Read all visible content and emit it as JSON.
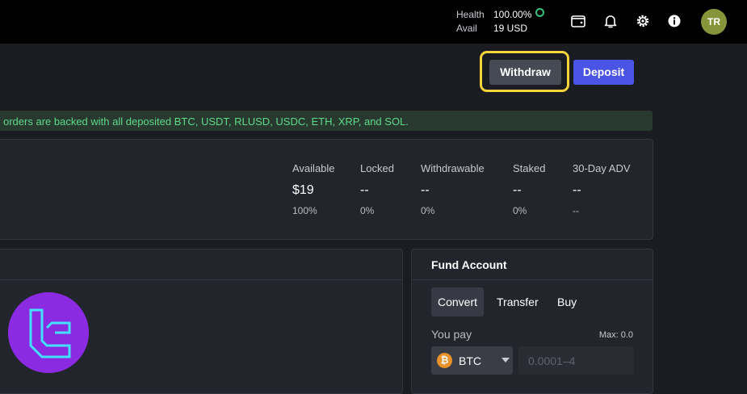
{
  "header": {
    "health_label": "Health",
    "health_value": "100.00%",
    "avail_label": "Avail",
    "avail_value": "19 USD",
    "avatar_initials": "TR",
    "icons": [
      "wallet-icon",
      "bell-icon",
      "gear-icon",
      "info-icon"
    ]
  },
  "actions": {
    "withdraw": "Withdraw",
    "deposit": "Deposit"
  },
  "banner": {
    "text": "orders are backed with all deposited BTC, USDT, RLUSD, USDC, ETH, XRP, and SOL."
  },
  "balances": [
    {
      "label": "Available",
      "value": "$19",
      "pct": "100%"
    },
    {
      "label": "Locked",
      "value": "--",
      "pct": "0%"
    },
    {
      "label": "Withdrawable",
      "value": "--",
      "pct": "0%"
    },
    {
      "label": "Staked",
      "value": "--",
      "pct": "0%"
    },
    {
      "label": "30-Day ADV",
      "value": "--",
      "pct": "--"
    }
  ],
  "fund": {
    "title": "Fund Account",
    "tabs": [
      "Convert",
      "Transfer",
      "Buy"
    ],
    "active_tab": "Convert",
    "you_pay": "You pay",
    "max": "Max: 0.0",
    "coin_symbol": "BTC",
    "coin_glyph": "₿",
    "amount_placeholder": "0.0001–4"
  },
  "colors": {
    "accent": "#4a55e6",
    "focus": "#f5d33a",
    "health_ok": "#35c27a",
    "banner_text": "#5fd98a",
    "logo": "#8a2be2"
  }
}
